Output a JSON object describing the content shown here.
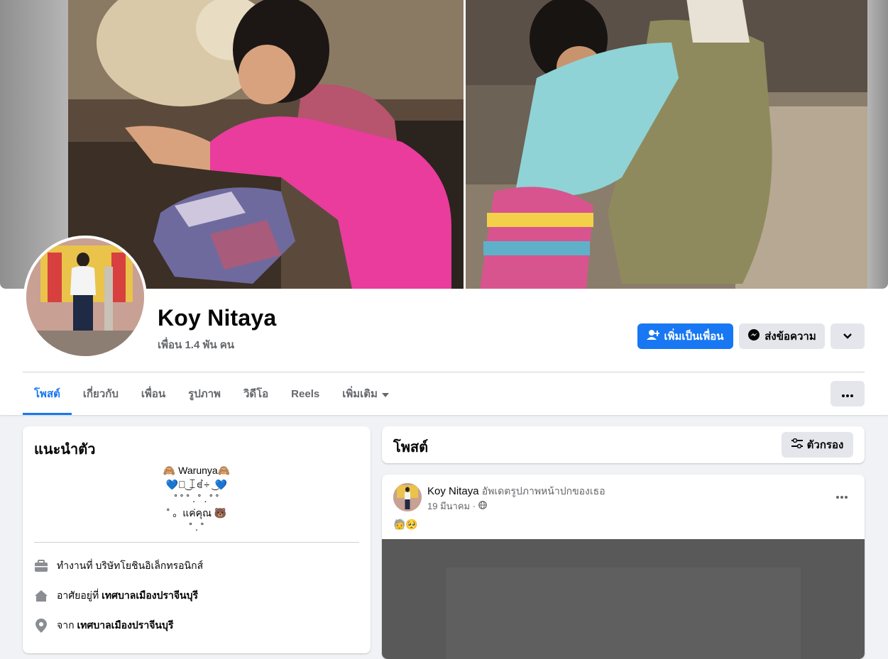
{
  "profile": {
    "name": "Koy Nitaya",
    "friends": "เพื่อน 1.4 พัน คน"
  },
  "actions": {
    "add_friend": "เพิ่มเป็นเพื่อน",
    "message": "ส่งข้อความ"
  },
  "tabs": [
    {
      "label": "โพสต์",
      "active": true
    },
    {
      "label": "เกี่ยวกับ"
    },
    {
      "label": "เพื่อน"
    },
    {
      "label": "รูปภาพ"
    },
    {
      "label": "วิดีโอ"
    },
    {
      "label": "Reels"
    },
    {
      "label": "เพิ่มเติม"
    }
  ],
  "intro": {
    "title": "แนะนำตัว",
    "bio_lines": [
      "🙈 Warunya🙈",
      "💙ꀘ͜ ꀤꀸ÷ ͜ 💙",
      "˚ ˚ ˚ . ˚ . ˚ ˚",
      "˚ 。แค่คุณ 🐻",
      "˚ . ˚"
    ],
    "work_prefix": "ทำงานที่ ",
    "work_value": "บริษัทโยชินอิเล็กทรอนิกส์",
    "lives_prefix": "อาศัยอยู่ที่ ",
    "lives_value": "เทศบาลเมืองปราจีนบุรี",
    "from_prefix": "จาก ",
    "from_value": "เทศบาลเมืองปราจีนบุรี"
  },
  "posts_section": {
    "title": "โพสต์",
    "filter_label": "ตัวกรอง"
  },
  "post": {
    "author": "Koy Nitaya",
    "action": "อัพเดตรูปภาพหน้าปกของเธอ",
    "date": "19 มีนาคม ·",
    "text": "🧓🥺"
  },
  "colors": {
    "accent": "#1877f2",
    "background": "#f0f2f5",
    "secondary_text": "#65676b",
    "gray_button": "#e4e6eb"
  },
  "icons": [
    "add-friend-icon",
    "messenger-icon",
    "chevron-down-icon",
    "more-icon",
    "filter-icon",
    "briefcase-icon",
    "home-icon",
    "location-pin-icon",
    "globe-icon",
    "caret-down-icon"
  ]
}
